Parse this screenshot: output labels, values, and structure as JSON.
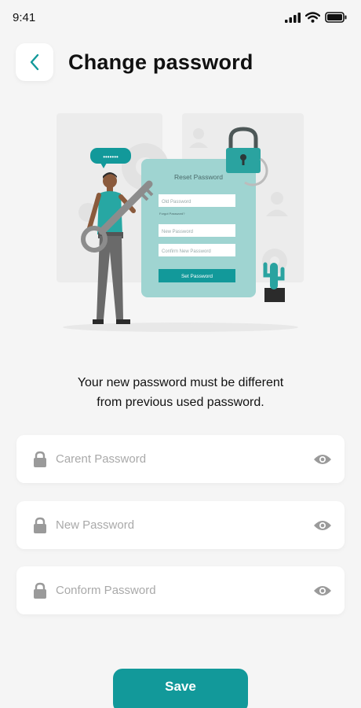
{
  "status_bar": {
    "time": "9:41",
    "icons": [
      "signal-icon",
      "wifi-icon",
      "battery-icon"
    ]
  },
  "header": {
    "back_icon": "chevron-left-icon",
    "title": "Change password"
  },
  "illustration": {
    "bubble_text": "•••••••",
    "card_title": "Reset Password",
    "old_password": "Old Password",
    "forgot_password": "Forgot Password?",
    "new_password": "New Password",
    "confirm_password": "Confirm New Password",
    "button": "Set Password"
  },
  "subtitle": {
    "line1": "Your new password must be different",
    "line2": "from previous used password."
  },
  "fields": [
    {
      "placeholder": "Carent Password",
      "icon": "lock-icon",
      "toggle_icon": "eye-icon"
    },
    {
      "placeholder": "New Password",
      "icon": "lock-icon",
      "toggle_icon": "eye-icon"
    },
    {
      "placeholder": "Conform Password",
      "icon": "lock-icon",
      "toggle_icon": "eye-icon"
    }
  ],
  "save": {
    "label": "Save"
  },
  "colors": {
    "accent": "#12999a",
    "illustration_teal": "#9fd4d1",
    "background": "#f5f5f5",
    "placeholder": "#a9a9a9"
  }
}
